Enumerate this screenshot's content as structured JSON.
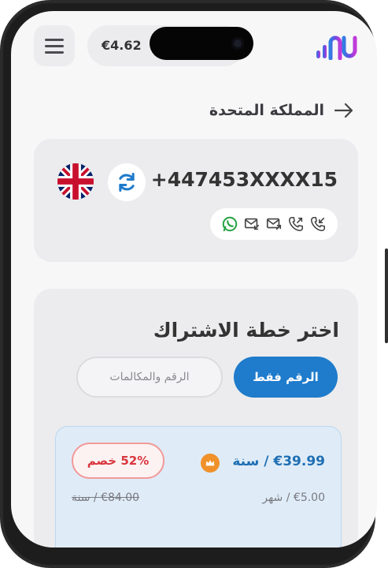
{
  "header": {
    "balance": "€4.62",
    "menu_icon": "hamburger-menu-icon",
    "logo_icon": "app-logo"
  },
  "country": {
    "title": "المملكة المتحدة",
    "back_icon": "arrow-right-icon"
  },
  "number_card": {
    "phone_number": "+447453XXXX15",
    "flag_icon": "uk-flag-icon",
    "refresh_icon": "refresh-icon",
    "capabilities": [
      "incoming-call-icon",
      "outgoing-call-icon",
      "sms-send-icon",
      "sms-receive-icon",
      "whatsapp-icon"
    ]
  },
  "plans": {
    "title": "اختر خطة الاشتراك",
    "tab_number_only": "الرقم فقط",
    "tab_number_calls": "الرقم والمكالمات",
    "offer": {
      "price": "€39.99 / سنة",
      "discount": "52% خصم",
      "monthly": "€5.00 / شهر",
      "old_price": "€84.00 / سنة",
      "crown_icon": "crown-icon"
    }
  },
  "colors": {
    "accent": "#1f7bcb",
    "discount": "#d9363e",
    "crown": "#f0912a"
  }
}
